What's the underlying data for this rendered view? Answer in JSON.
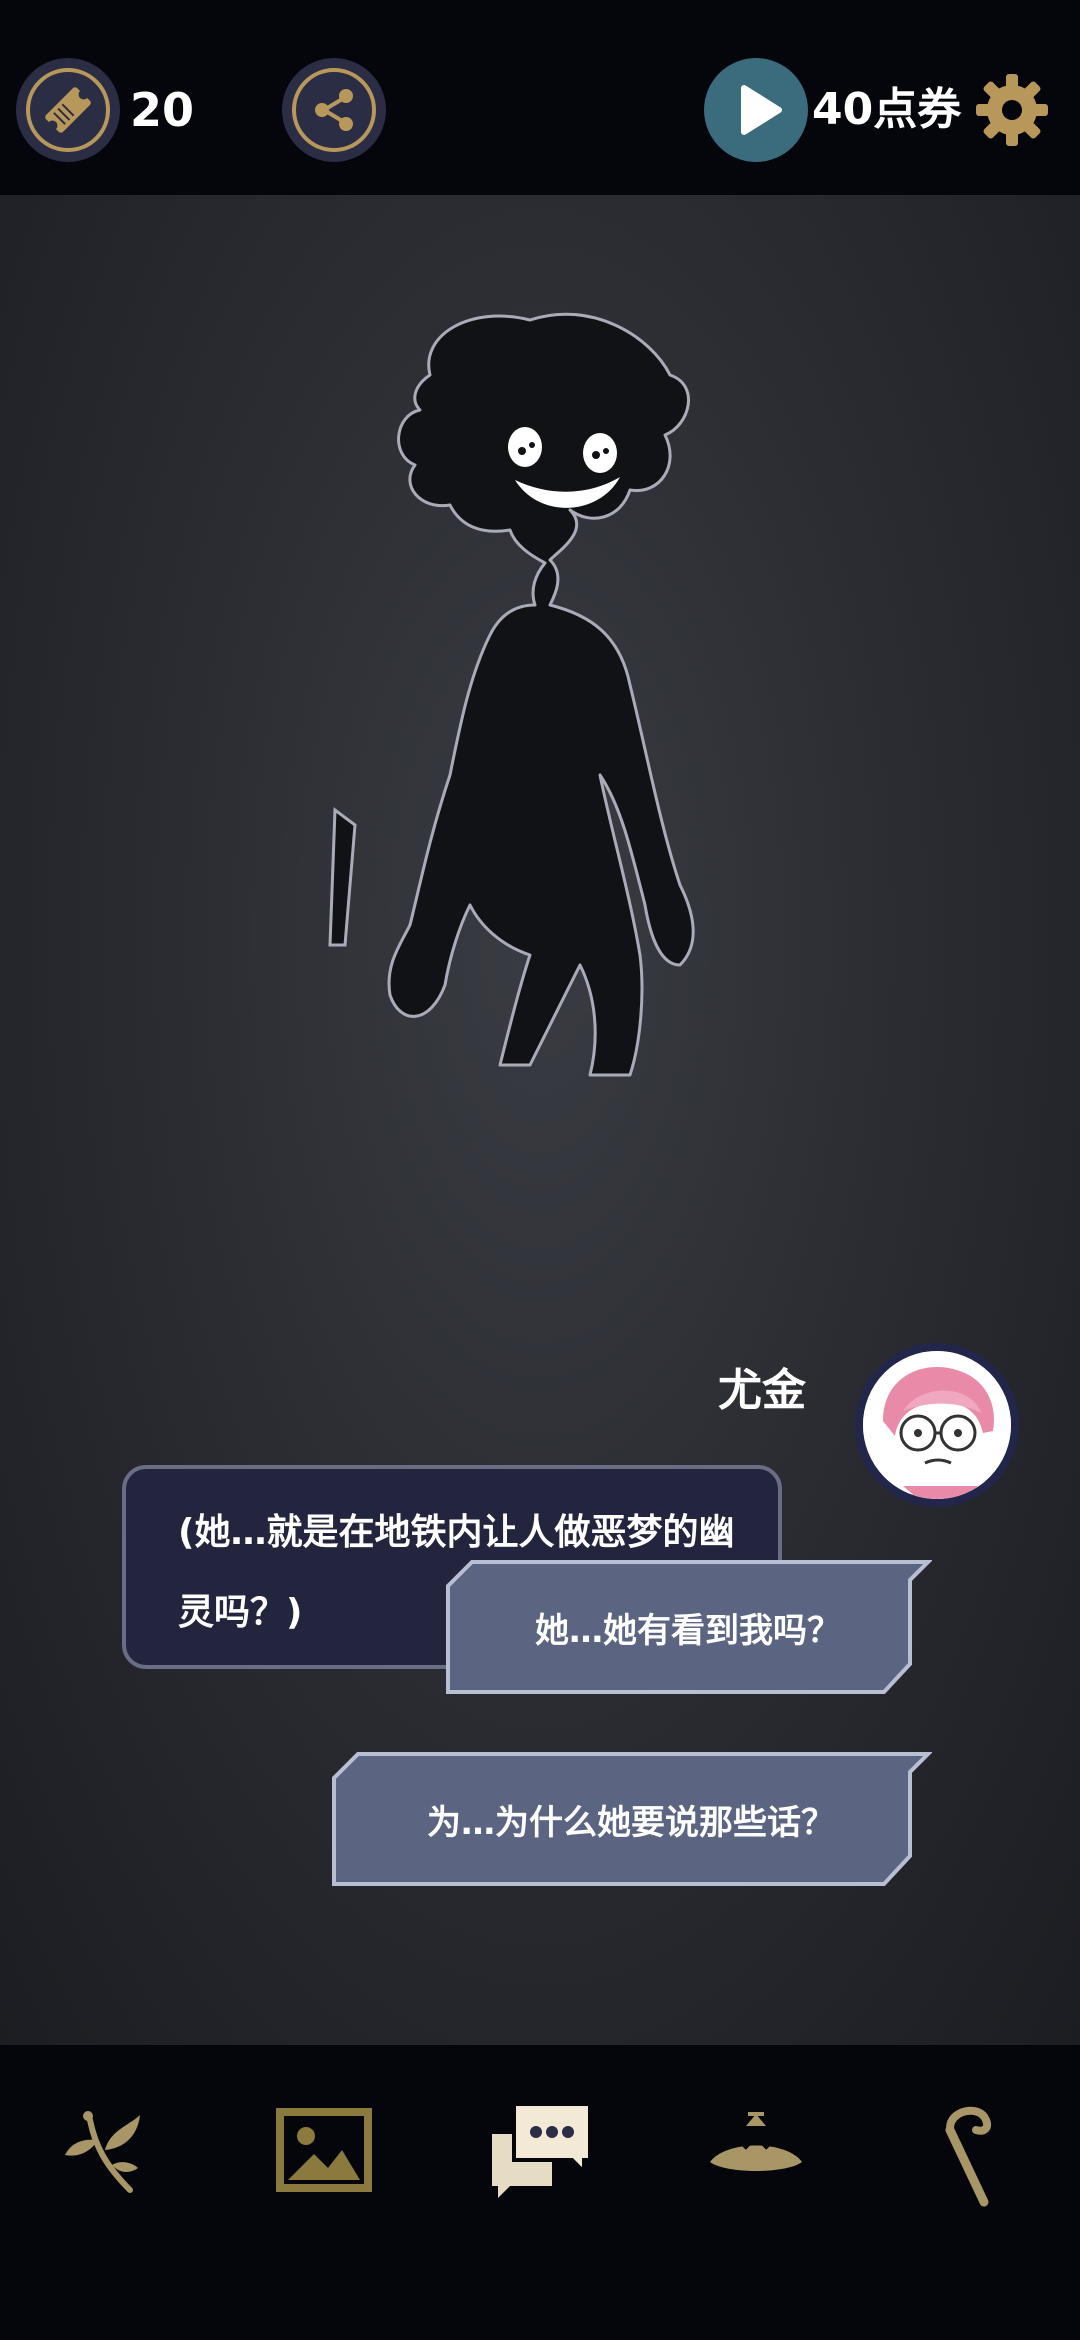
{
  "topbar": {
    "ticket_count": "20",
    "points_label": "40点券",
    "icons": [
      "ticket-icon",
      "share-icon",
      "play-icon",
      "gear-icon"
    ]
  },
  "scene": {
    "speaker": "尤金",
    "dialog": "(她…就是在地铁内让人做恶梦的幽灵吗？)",
    "choices": [
      "她…她有看到我吗？",
      "为…为什么她要说那些话？"
    ]
  },
  "bottom_nav": {
    "items": [
      "herb-icon",
      "gallery-icon",
      "chat-icon",
      "bell-icon",
      "cane-icon"
    ]
  },
  "colors": {
    "gold": "#b8985a",
    "dialog_bg": "#23253f",
    "choice_bg": "#5b6582",
    "play_bg": "#3a6c7d"
  }
}
